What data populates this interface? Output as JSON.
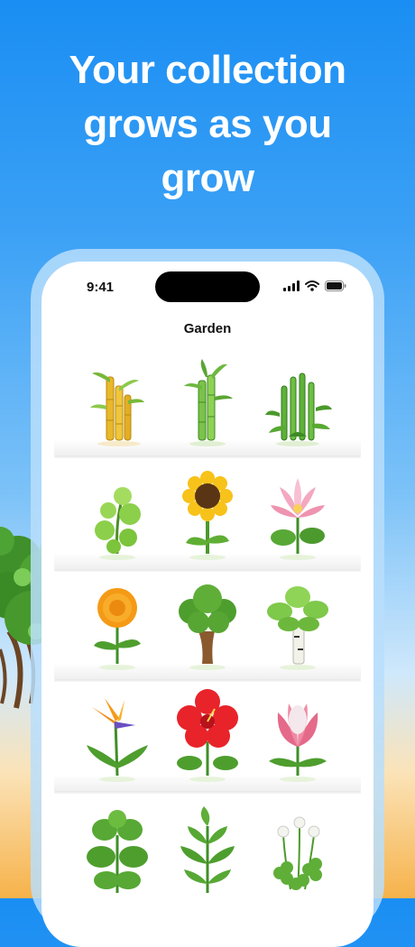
{
  "headline": {
    "line1": "Your collection",
    "line2": "grows as you",
    "line3": "grow"
  },
  "status_bar": {
    "time": "9:41"
  },
  "screen": {
    "title": "Garden"
  },
  "plants": [
    [
      "bamboo-icon",
      "bamboo-icon",
      "bamboo-icon"
    ],
    [
      "jade-plant-icon",
      "sunflower-icon",
      "lotus-icon"
    ],
    [
      "marigold-icon",
      "bonsai-tree-icon",
      "birch-tree-icon"
    ],
    [
      "bird-of-paradise-icon",
      "hibiscus-icon",
      "protea-icon"
    ],
    [
      "basil-icon",
      "mint-icon",
      "clover-icon"
    ]
  ],
  "colors": {
    "sky_top": "#1a8ef3",
    "sky_bottom": "#f6b24a",
    "screen_bg": "#ffffff"
  }
}
